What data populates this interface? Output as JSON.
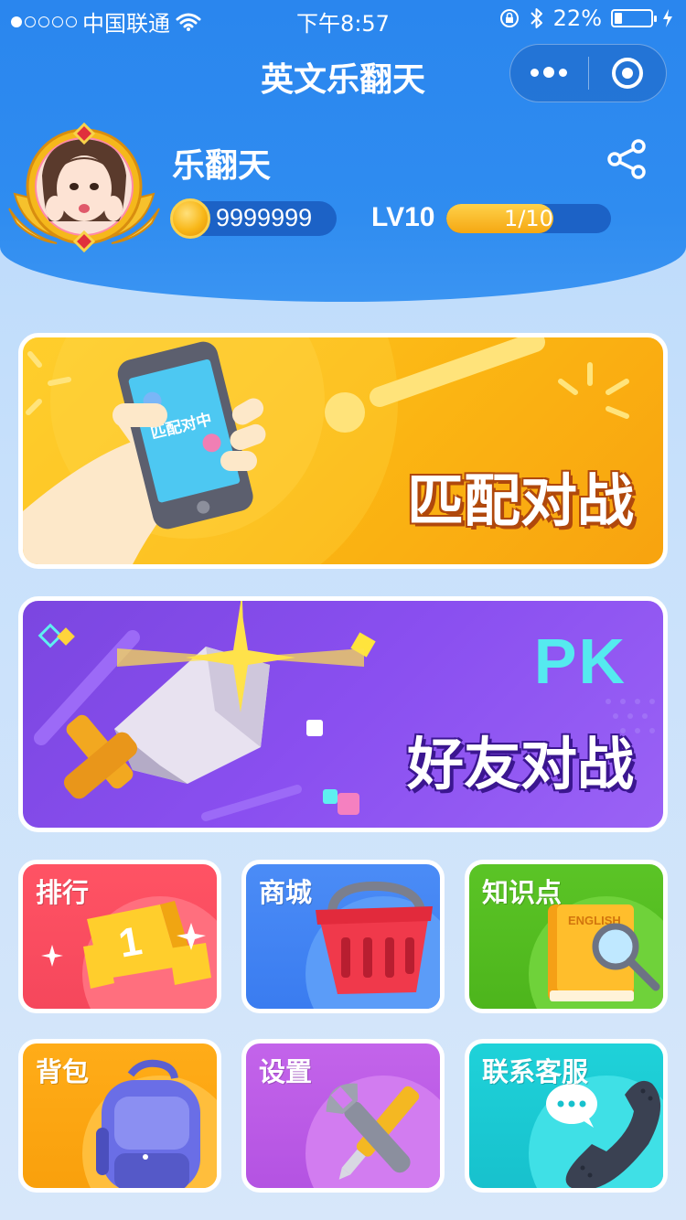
{
  "status_bar": {
    "carrier": "中国联通",
    "time": "下午8:57",
    "battery": "22%",
    "battery_level": 0.22,
    "signal_bars_filled": 1,
    "signal_bars_total": 5
  },
  "nav": {
    "title": "英文乐翻天"
  },
  "profile": {
    "username": "乐翻天",
    "coins": "9999999",
    "level_label": "LV10",
    "level_progress_text": "1/10",
    "level_progress": 0.65
  },
  "banners": {
    "match": {
      "title": "匹配对战",
      "phone_text": "匹配对中"
    },
    "friend": {
      "title": "好友对战",
      "badge": "PK"
    }
  },
  "tiles": {
    "rank": "排行",
    "shop": "商城",
    "knowledge": "知识点",
    "bag": "背包",
    "settings": "设置",
    "service": "联系客服",
    "book_text": "ENGLISH"
  },
  "colors": {
    "header": "#2f8cf0",
    "match_banner": "#fbb513",
    "friend_banner": "#8a4ff0",
    "pk": "#55eaef"
  }
}
